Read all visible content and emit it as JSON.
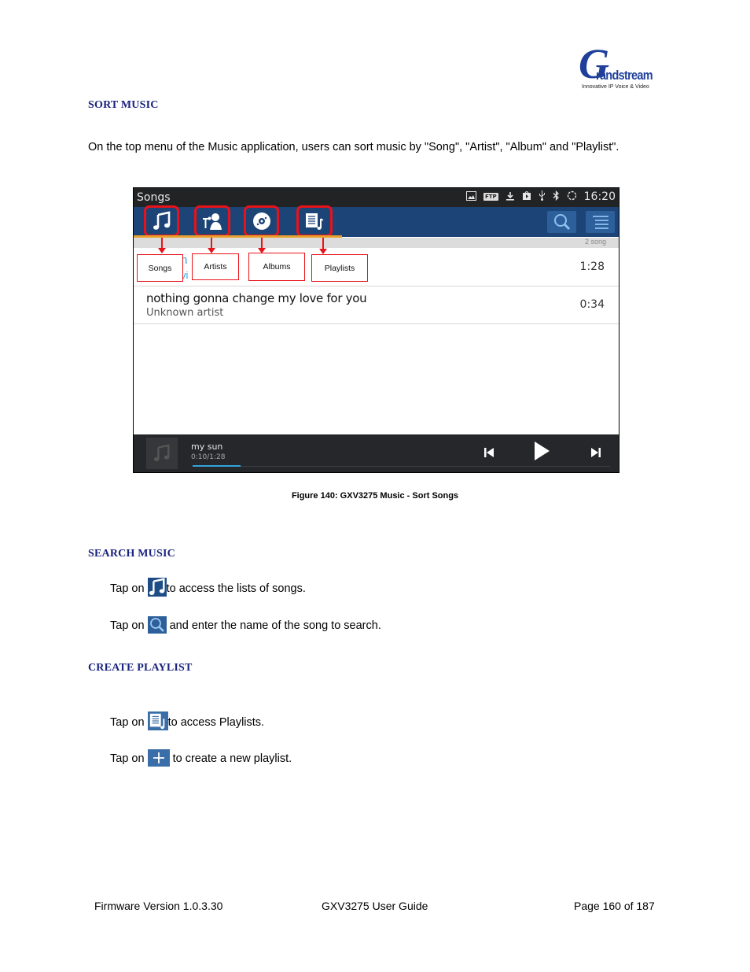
{
  "header": {
    "logo": {
      "letter": "G",
      "wordmark": "randstream",
      "tagline": "Innovative IP Voice & Video"
    }
  },
  "sections": {
    "sort_music": {
      "heading": "SORT MUSIC",
      "paragraph": "On the top menu of the Music application, users can sort music by \"Song\", \"Artist\", \"Album\" and \"Playlist\"."
    },
    "search_music": {
      "heading": "SEARCH MUSIC",
      "steps": [
        {
          "prefix": "Tap on",
          "icon": "music-note-icon",
          "suffix": "to access the lists of songs."
        },
        {
          "prefix": "Tap on",
          "icon": "search-icon",
          "suffix": "and enter the name of the song to search."
        }
      ]
    },
    "create_playlist": {
      "heading": "CREATE PLAYLIST",
      "steps": [
        {
          "prefix": "Tap on",
          "icon": "playlist-icon",
          "suffix": "to access Playlists."
        },
        {
          "prefix": "Tap on",
          "icon": "plus-icon",
          "suffix": "to create a new playlist."
        }
      ]
    }
  },
  "figure": {
    "caption": "Figure 140: GXV3275 Music - Sort Songs",
    "screen": {
      "status_bar": {
        "title": "Songs",
        "icons": [
          "image-icon",
          "ftp-icon",
          "download-icon",
          "store-icon",
          "usb-icon",
          "bluetooth-icon",
          "sync-icon"
        ],
        "ftp_label": "FTP",
        "time": "16:20"
      },
      "tabs": [
        {
          "name": "songs",
          "icon": "music-note-icon"
        },
        {
          "name": "artists",
          "icon": "artist-icon"
        },
        {
          "name": "albums",
          "icon": "album-icon"
        },
        {
          "name": "playlists",
          "icon": "playlist-icon"
        }
      ],
      "toolbar_buttons": [
        "search-icon",
        "menu-icon"
      ],
      "song_count": "2 song",
      "songs": [
        {
          "title": "my sun",
          "artist": "Unknown artist",
          "duration": "1:28"
        },
        {
          "title": "nothing gonna change my love for you",
          "artist": "Unknown artist",
          "duration": "0:34"
        }
      ],
      "partial_first_row": {
        "title_fragment": "n",
        "artist_fragment": "vi"
      },
      "player": {
        "title": "my sun",
        "time": "0:10/1:28",
        "progress": 0.114
      }
    },
    "callouts": [
      "Songs",
      "Artists",
      "Albums",
      "Playlists"
    ],
    "colors": {
      "highlight": "#e8121a",
      "toolbar": "#1d4476",
      "tab_indicator": "#e8a12a",
      "progress": "#33a3dc"
    }
  },
  "footer": {
    "left": "Firmware Version 1.0.3.30",
    "center": "GXV3275 User Guide",
    "right": "Page 160 of 187"
  }
}
